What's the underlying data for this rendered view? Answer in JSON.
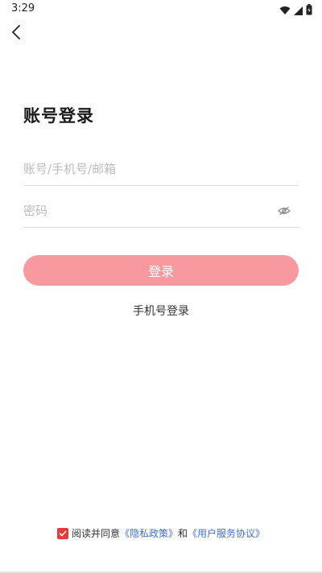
{
  "status_bar": {
    "time": "3:29",
    "icons": [
      "wifi-icon",
      "signal-icon",
      "battery-icon"
    ]
  },
  "nav": {
    "back_icon": "chevron-left-icon"
  },
  "page": {
    "title": "账号登录"
  },
  "form": {
    "account": {
      "value": "",
      "placeholder": "账号/手机号/邮箱"
    },
    "password": {
      "value": "",
      "placeholder": "密码",
      "toggle_icon": "eye-icon"
    }
  },
  "actions": {
    "login_label": "登录",
    "login_color": "#f7999f",
    "phone_login_label": "手机号登录"
  },
  "agreement": {
    "checked": true,
    "checkbox_color": "#e63b3b",
    "prefix": "阅读并同意",
    "privacy_link": "《隐私政策》",
    "connector": "和",
    "terms_link": "《用户服务协议》",
    "link_color": "#3d6fd8"
  }
}
